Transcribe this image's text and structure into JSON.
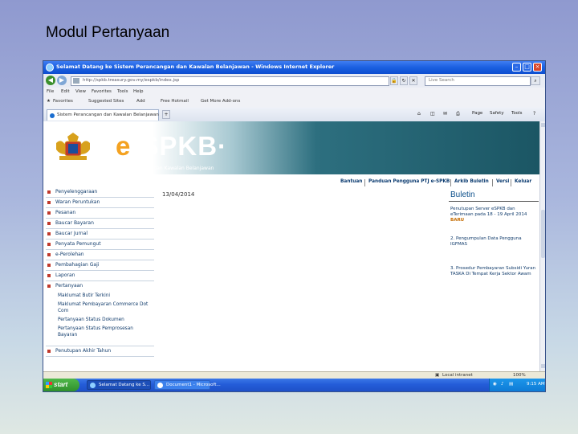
{
  "slide": {
    "title": "Modul Pertanyaan"
  },
  "browser": {
    "window_title": "Selamat Datang ke Sistem Perancangan dan Kawalan Belanjawan - Windows Internet Explorer",
    "address": "http://spkb.treasury.gov.my/espkb/index.jsp",
    "search_placeholder": "Live Search",
    "menu": [
      "File",
      "Edit",
      "View",
      "Favorites",
      "Tools",
      "Help"
    ],
    "links": [
      "Favorites",
      "Suggested Sites",
      "Add",
      "Free Hotmail",
      "Get More Add-ons"
    ],
    "tab_label": "Sistem Perancangan dan Kawalan Belanjawan",
    "tools": [
      "Page",
      "Safety",
      "Tools"
    ],
    "status_zone": "Local intranet",
    "zoom": "100%"
  },
  "site": {
    "logo_prefix": "e",
    "logo_main": "SPKB",
    "subtitle": "Sistem Perancangan dan Kawalan Belanjawan",
    "top_nav": [
      "Bantuan",
      "Panduan Pengguna PTJ e-SPKB",
      "Arkib Buletin",
      "Versi",
      "Keluar"
    ],
    "date": "13/04/2014",
    "left_menu": [
      "Penyelenggaraan",
      "Waran Peruntukan",
      "Pesanan",
      "Baucar Bayaran",
      "Baucar Jurnal",
      "Penyata Pemungut",
      "e-Perolehan",
      "Pembahagian Gaji",
      "Laporan",
      "Pertanyaan"
    ],
    "sub_menu": [
      "Maklumat Butir Terkini",
      "Maklumat Pembayaran Commerce Dot Com",
      "Pertanyaan Status Dokumen",
      "Pertanyaan Status Pemprosesan Bayaran"
    ],
    "last_menu": "Penutupan Akhir Tahun"
  },
  "bulletin": {
    "title": "Buletin",
    "items": [
      {
        "text": "Penutupan Server eSPKB dan eTerimaan pada 18 - 19 April 2014",
        "badge": "BARU"
      },
      {
        "text": "2. Pengumpulan Data Pengguna IGFMAS",
        "badge": ""
      },
      {
        "text": "3. Prosedur Pembayaran Subsidi Yuran TASKA Di Tempat Kerja Sektor Awam",
        "badge": ""
      }
    ]
  },
  "taskbar": {
    "start_label": "start",
    "tasks": [
      "Selamat Datang ke S...",
      "Document1 - Microsoft..."
    ],
    "clock": "9:15 AM"
  }
}
